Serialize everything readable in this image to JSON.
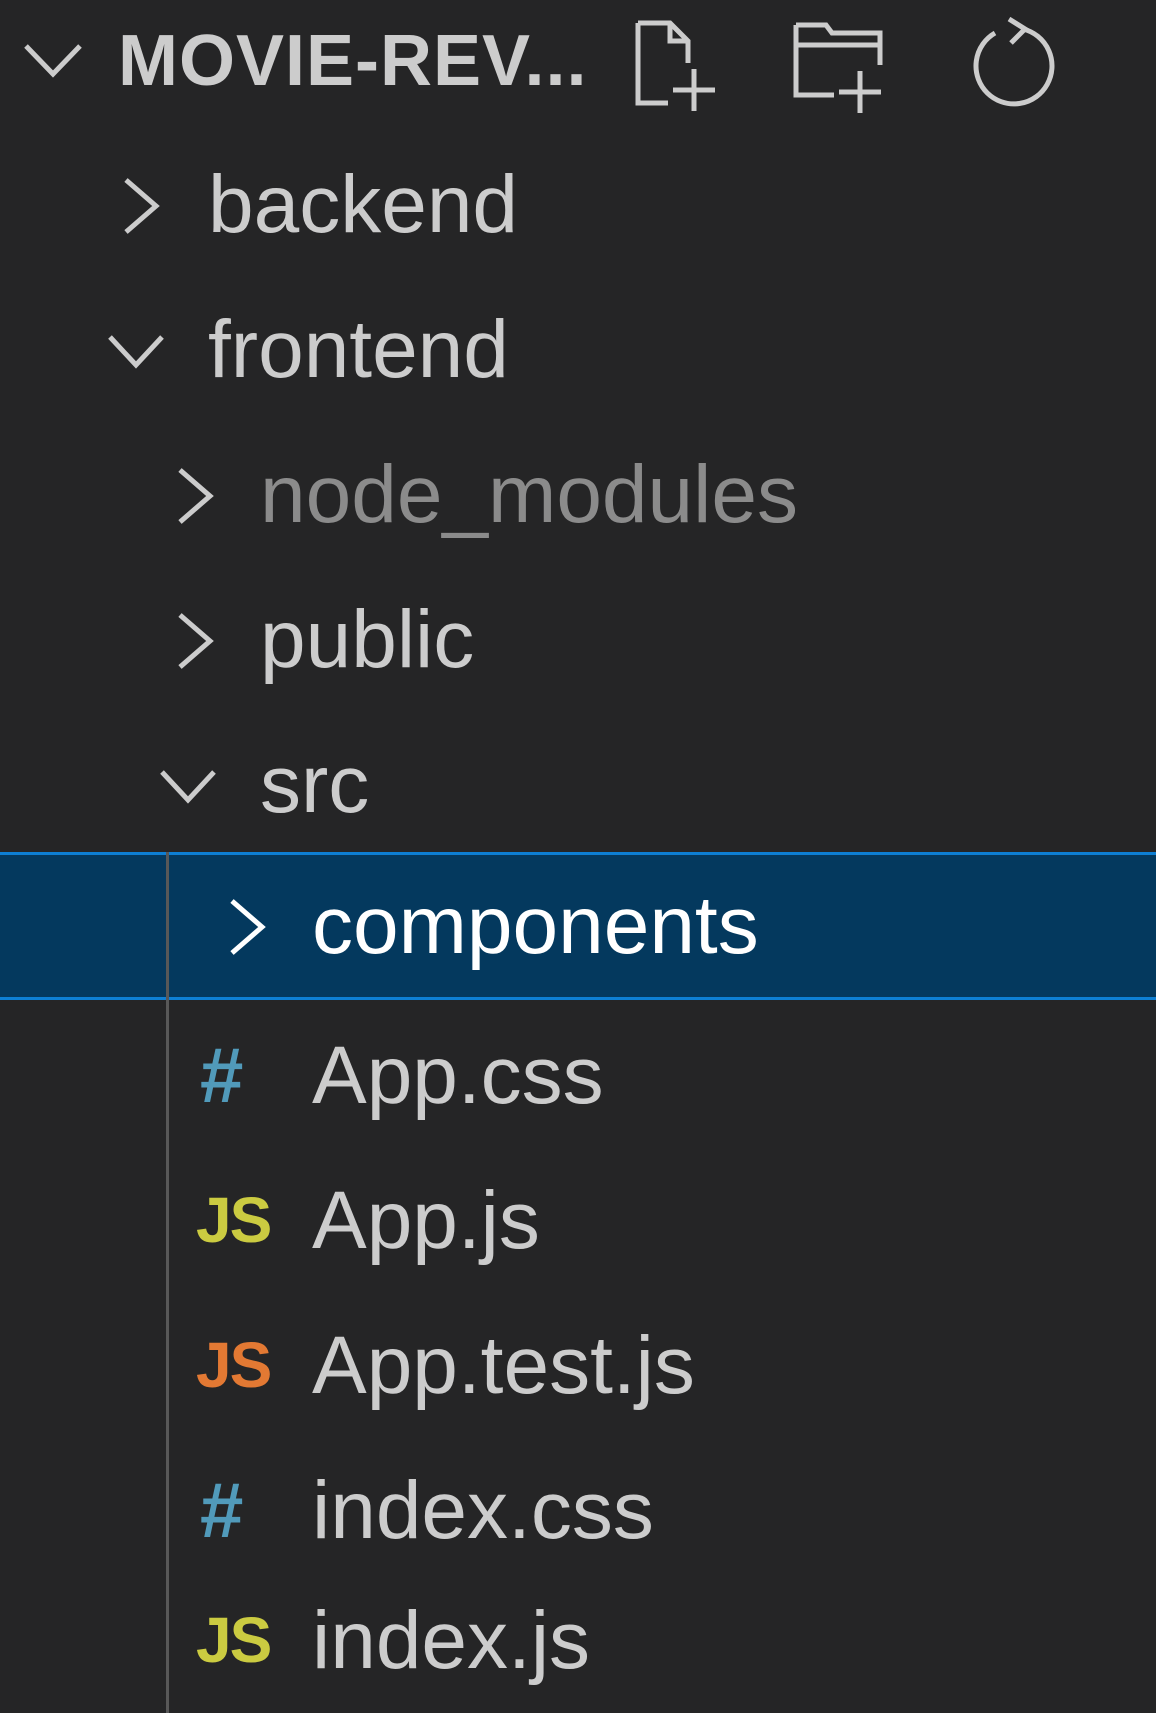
{
  "explorer": {
    "title": "MOVIE-REV...",
    "actions": {
      "new_file": "new-file-icon",
      "new_folder": "new-folder-icon",
      "refresh": "refresh-icon"
    },
    "icon_colors": {
      "css": "#519aba",
      "js": "#cbcb41",
      "test_js": "#e37933",
      "selection_bg": "#04395e",
      "selection_border": "#0e7fd3"
    }
  },
  "tree": {
    "backend": "backend",
    "frontend": "frontend",
    "node_modules": "node_modules",
    "public": "public",
    "src": "src",
    "components": "components",
    "app_css": "App.css",
    "app_js": "App.js",
    "app_test_js": "App.test.js",
    "index_css": "index.css",
    "index_js": "index.js"
  },
  "icons": {
    "css_glyph": "#",
    "js_glyph": "JS"
  }
}
